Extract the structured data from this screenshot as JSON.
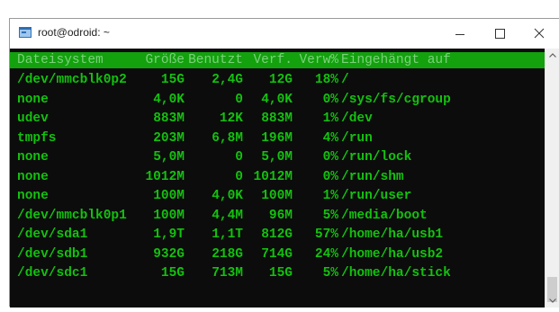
{
  "window": {
    "title": "root@odroid: ~",
    "icons": {
      "app": "terminal-app-icon",
      "minimize": "minimize-icon",
      "maximize": "maximize-icon",
      "close": "close-icon",
      "scroll_up": "chevron-up-icon",
      "scroll_down": "chevron-down-icon"
    }
  },
  "colors": {
    "terminal_bg": "#0c0c0c",
    "text_green": "#13c10e",
    "header_bg": "#13a10e",
    "header_text": "#7bd27a"
  },
  "df": {
    "header": {
      "filesystem": "Dateisystem",
      "size": "Größe",
      "used": "Benutzt",
      "avail": "Verf.",
      "pct": "Verw%",
      "mount": "Eingehängt auf"
    },
    "rows": [
      {
        "filesystem": "/dev/mmcblk0p2",
        "size": "15G",
        "used": "2,4G",
        "avail": "12G",
        "pct": "18%",
        "mount": "/"
      },
      {
        "filesystem": "none",
        "size": "4,0K",
        "used": "0",
        "avail": "4,0K",
        "pct": "0%",
        "mount": "/sys/fs/cgroup"
      },
      {
        "filesystem": "udev",
        "size": "883M",
        "used": "12K",
        "avail": "883M",
        "pct": "1%",
        "mount": "/dev"
      },
      {
        "filesystem": "tmpfs",
        "size": "203M",
        "used": "6,8M",
        "avail": "196M",
        "pct": "4%",
        "mount": "/run"
      },
      {
        "filesystem": "none",
        "size": "5,0M",
        "used": "0",
        "avail": "5,0M",
        "pct": "0%",
        "mount": "/run/lock"
      },
      {
        "filesystem": "none",
        "size": "1012M",
        "used": "0",
        "avail": "1012M",
        "pct": "0%",
        "mount": "/run/shm"
      },
      {
        "filesystem": "none",
        "size": "100M",
        "used": "4,0K",
        "avail": "100M",
        "pct": "1%",
        "mount": "/run/user"
      },
      {
        "filesystem": "/dev/mmcblk0p1",
        "size": "100M",
        "used": "4,4M",
        "avail": "96M",
        "pct": "5%",
        "mount": "/media/boot"
      },
      {
        "filesystem": "/dev/sda1",
        "size": "1,9T",
        "used": "1,1T",
        "avail": "812G",
        "pct": "57%",
        "mount": "/home/ha/usb1"
      },
      {
        "filesystem": "/dev/sdb1",
        "size": "932G",
        "used": "218G",
        "avail": "714G",
        "pct": "24%",
        "mount": "/home/ha/usb2"
      },
      {
        "filesystem": "/dev/sdc1",
        "size": "15G",
        "used": "713M",
        "avail": "15G",
        "pct": "5%",
        "mount": "/home/ha/stick"
      }
    ]
  }
}
